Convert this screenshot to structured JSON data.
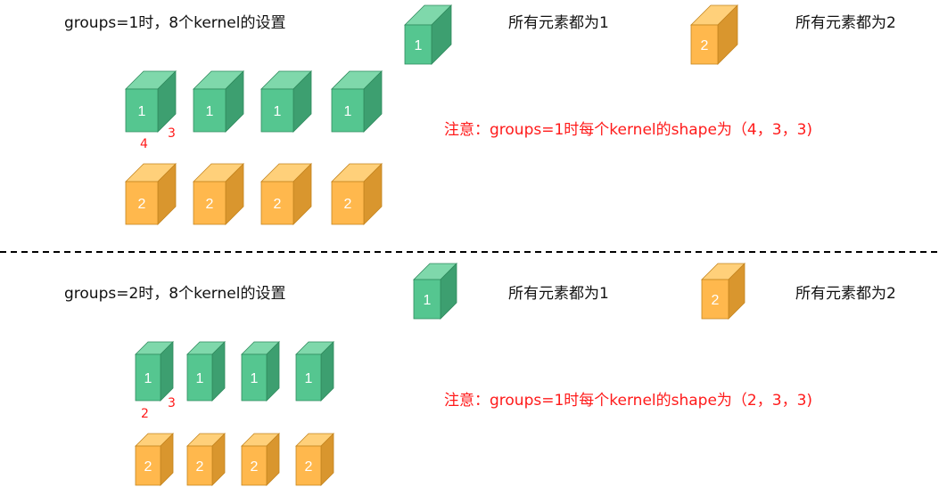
{
  "sections": [
    {
      "heading": "groups=1时，8个kernel的设置",
      "legend": [
        {
          "label": "1",
          "text": "所有元素都为1"
        },
        {
          "label": "2",
          "text": "所有元素都为2"
        }
      ],
      "note": "注意：groups=1时每个kernel的shape为（4，3，3)",
      "kernel_labels": {
        "green": "1",
        "orange": "2"
      },
      "dims": {
        "depth": "3",
        "height": "4",
        "width": "3"
      }
    },
    {
      "heading": "groups=2时，8个kernel的设置",
      "legend": [
        {
          "label": "1",
          "text": "所有元素都为1"
        },
        {
          "label": "2",
          "text": "所有元素都为2"
        }
      ],
      "note": "注意：groups=1时每个kernel的shape为（2，3，3)",
      "kernel_labels": {
        "green": "1",
        "orange": "2"
      },
      "dims": {
        "depth": "3",
        "height": "2",
        "width": "3"
      }
    }
  ],
  "colors": {
    "green_front": "#55c690",
    "green_top": "#7fd8ab",
    "green_side": "#3d9f70",
    "orange_front": "#ffb84d",
    "orange_top": "#ffd07a",
    "orange_side": "#d9962e",
    "note_red": "#ff1a1a"
  }
}
